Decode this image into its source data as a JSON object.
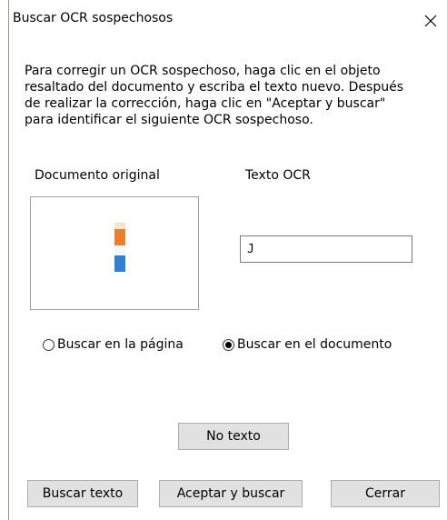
{
  "dialog": {
    "title": "Buscar OCR sospechosos",
    "close_icon": "close-icon"
  },
  "instructions": "Para corregir un OCR sospechoso, haga clic en el objeto\nresaltado del documento y escriba el texto nuevo. Después\nde realizar la corrección, haga clic en \"Aceptar y buscar\"\npara identificar el siguiente OCR sospechoso.",
  "original": {
    "label": "Documento original"
  },
  "ocr": {
    "label": "Texto OCR",
    "value": "J"
  },
  "scope": {
    "page_label": "Buscar en la página",
    "document_label": "Buscar en el documento",
    "selected": "document"
  },
  "buttons": {
    "no_text": "No texto",
    "search_text": "Buscar texto",
    "accept_search": "Aceptar y buscar",
    "close": "Cerrar"
  }
}
